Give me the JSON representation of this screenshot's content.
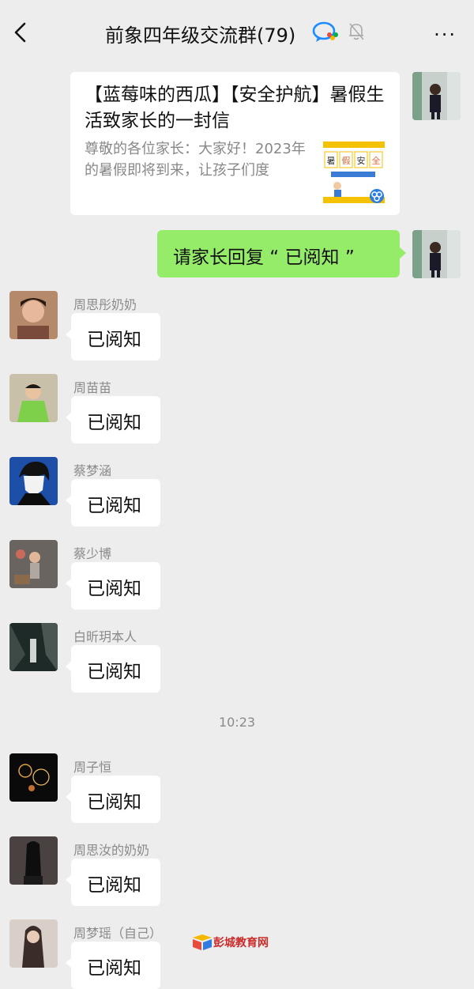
{
  "header": {
    "title": "前象四年级交流群(79)",
    "more_label": "···"
  },
  "card": {
    "title": "【蓝莓味的西瓜】【安全护航】暑假生活致家长的一封信",
    "description": "尊敬的各位家长：大家好！2023年的暑假即将到来，让孩子们度",
    "thumb_chars": [
      "暑",
      "假",
      "安",
      "全"
    ]
  },
  "request": {
    "text": "请家长回复 “ 已阅知 ”"
  },
  "messages": [
    {
      "name": "周思彤奶奶",
      "text": "已阅知"
    },
    {
      "name": "周苗苗",
      "text": "已阅知"
    },
    {
      "name": "蔡梦涵",
      "text": "已阅知"
    },
    {
      "name": "蔡少博",
      "text": "已阅知"
    },
    {
      "name": "白昕玥本人",
      "text": "已阅知"
    },
    {
      "name": "周子恒",
      "text": "已阅知"
    },
    {
      "name": "周思汝的奶奶",
      "text": "已阅知"
    },
    {
      "name": "周梦瑶（自己）",
      "text": "已阅知"
    }
  ],
  "time_divider": "10:23",
  "watermark": "彭城教育网",
  "colors": {
    "sent_bubble": "#95ec69",
    "background": "#ededed"
  },
  "icons": {
    "back": "back-arrow-icon",
    "group_tag": "wecom-icon",
    "mute": "mute-bell-icon",
    "more": "more-icon"
  }
}
